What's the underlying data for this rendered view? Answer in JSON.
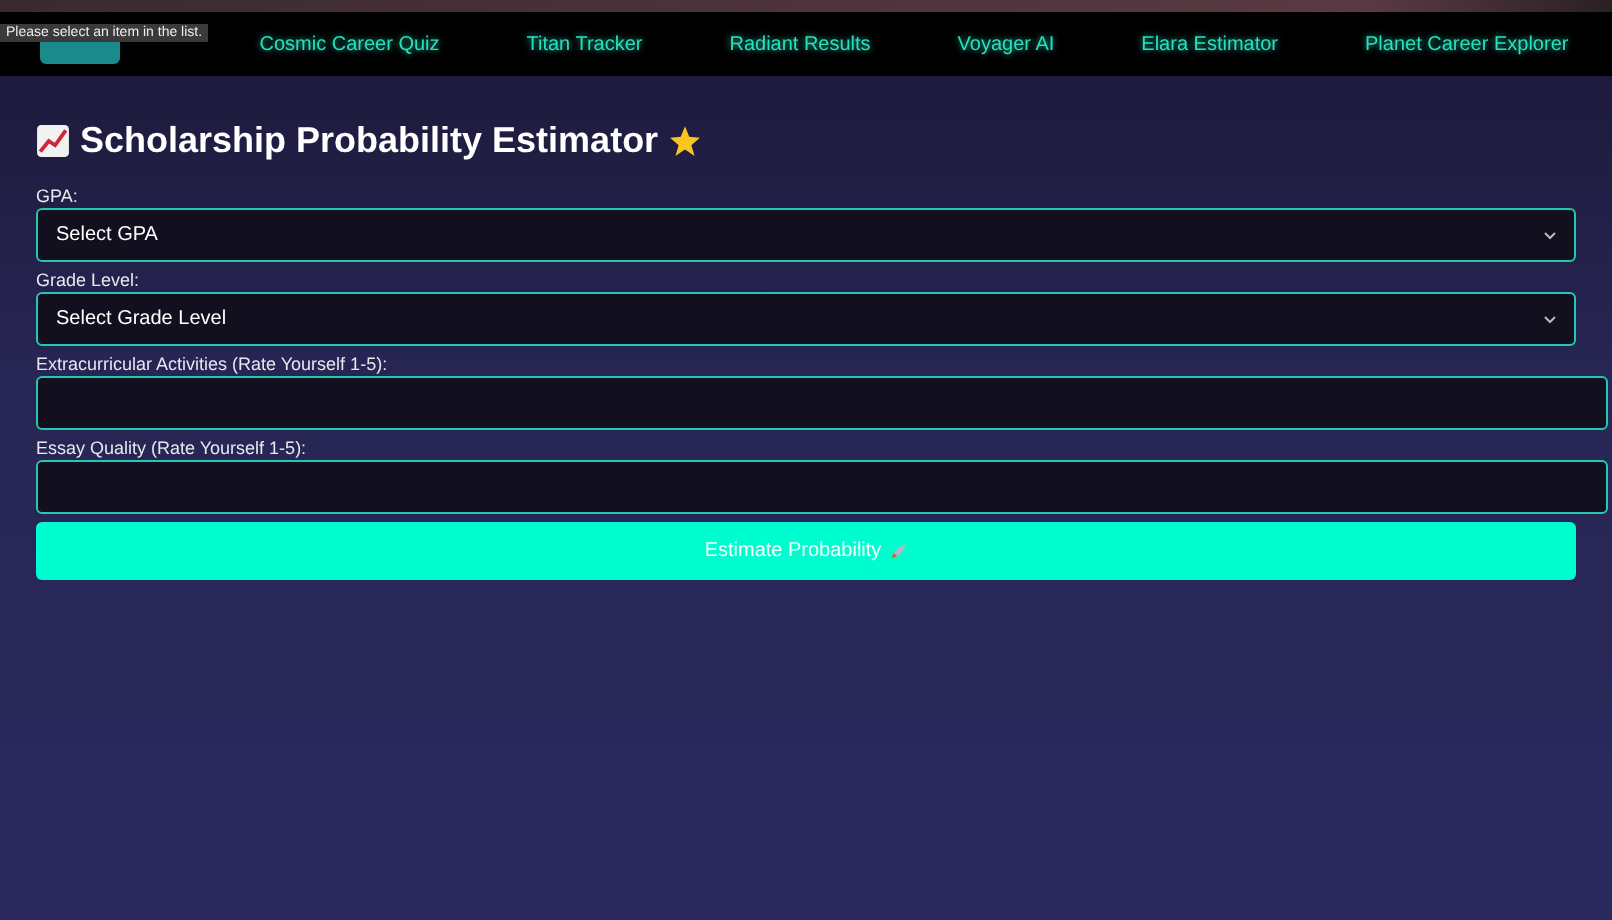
{
  "tooltip": "Please select an item in the list.",
  "nav": {
    "links": [
      "Cosmic Career Quiz",
      "Titan Tracker",
      "Radiant Results",
      "Voyager AI",
      "Elara Estimator",
      "Planet Career Explorer"
    ]
  },
  "title": "Scholarship Probability Estimator",
  "fields": [
    {
      "kind": "select",
      "label": "GPA:",
      "value": "Select GPA"
    },
    {
      "kind": "select",
      "label": "Grade Level:",
      "value": "Select Grade Level"
    },
    {
      "kind": "input",
      "label": "Extracurricular Activities (Rate Yourself 1-5):"
    },
    {
      "kind": "input",
      "label": "Essay Quality (Rate Yourself 1-5):"
    }
  ],
  "submit": "Estimate Probability"
}
